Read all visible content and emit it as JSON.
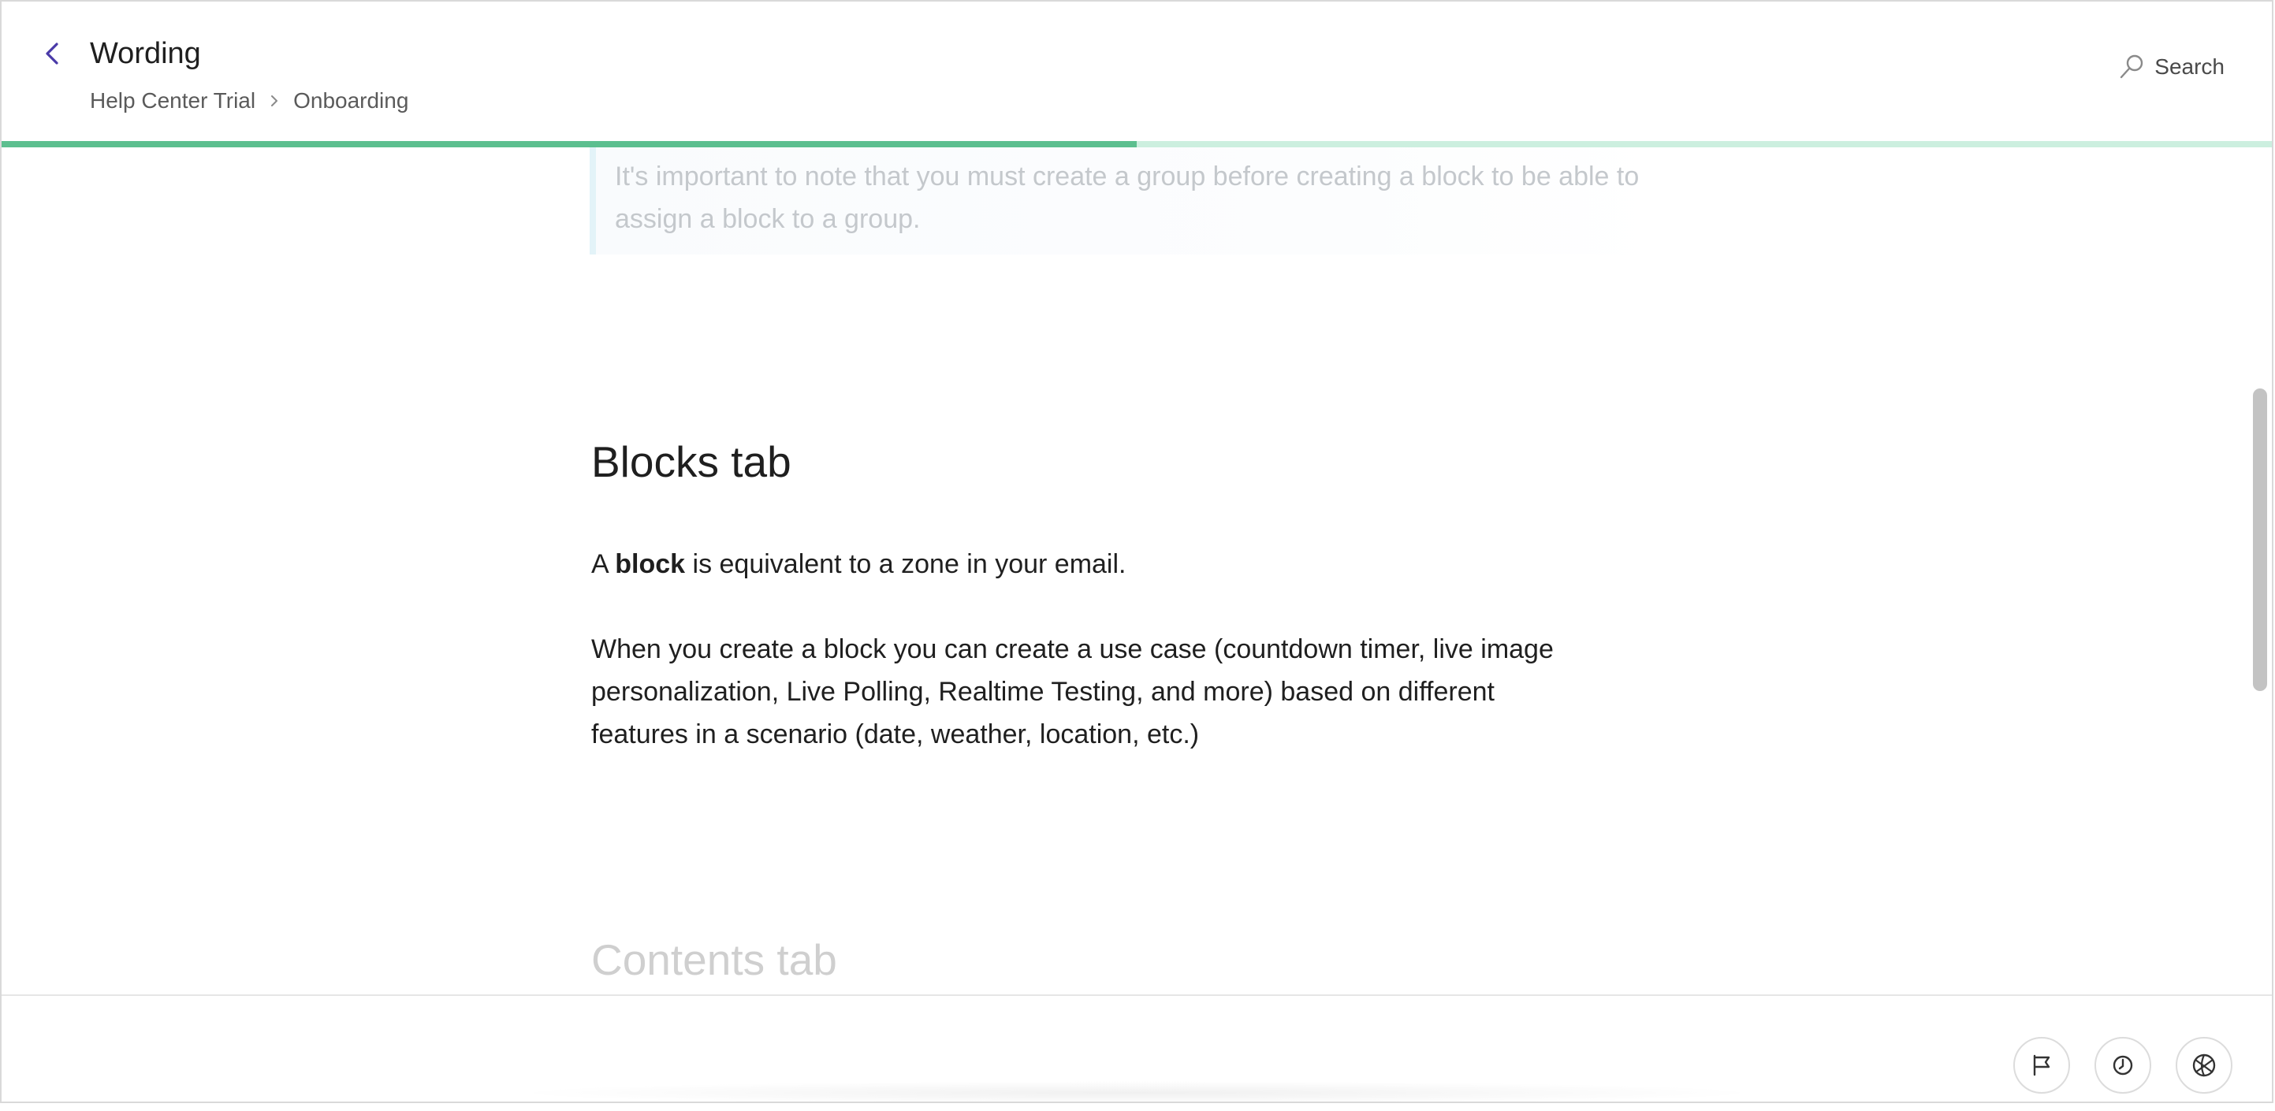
{
  "header": {
    "title": "Wording",
    "breadcrumb": [
      "Help Center Trial",
      "Onboarding"
    ],
    "search_label": "Search"
  },
  "progress": {
    "percent": 50,
    "fill_color": "#5cbf8f",
    "track_color": "#ccefdf"
  },
  "content": {
    "callout_text": "It's important to note that you must create a group before creating a block to be able to assign a block to a group.",
    "section_heading": "Blocks tab",
    "paragraph1": {
      "prefix": "A ",
      "bold": "block",
      "suffix": " is equivalent to a zone in your email."
    },
    "paragraph2_lines": [
      "When you create a block you can create a use case (countdown timer, live image",
      "personalization, Live Polling, Realtime Testing, and more) based on different",
      "features in a scenario (date, weather, location, etc.)"
    ],
    "next_heading": "Contents tab"
  },
  "footer": {
    "buttons": [
      {
        "icon": "flag-icon"
      },
      {
        "icon": "history-icon"
      },
      {
        "icon": "globe-icon"
      }
    ]
  },
  "colors": {
    "accent_back": "#4a3aa8",
    "text": "#1f1f1f",
    "muted": "#c4c8cc"
  }
}
